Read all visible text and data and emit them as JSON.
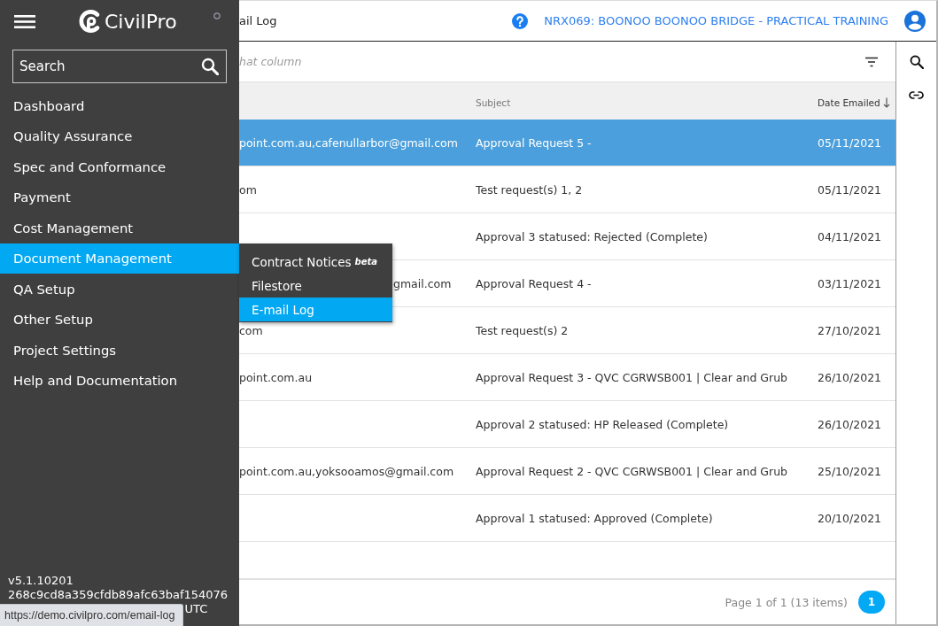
{
  "sidebar": {
    "brand": "CivilPro",
    "search": {
      "placeholder": "Search"
    },
    "items": [
      {
        "label": "Dashboard",
        "selected": false
      },
      {
        "label": "Quality Assurance",
        "selected": false
      },
      {
        "label": "Spec and Conformance",
        "selected": false
      },
      {
        "label": "Payment",
        "selected": false
      },
      {
        "label": "Cost Management",
        "selected": false
      },
      {
        "label": "Document Management",
        "selected": true,
        "expanded": true,
        "submenu": [
          {
            "label": "Contract Notices $^{beta}$",
            "selected": false
          },
          {
            "label": "Filestore",
            "selected": false
          },
          {
            "label": "E-mail Log",
            "selected": true
          }
        ]
      },
      {
        "label": "QA Setup",
        "selected": false
      },
      {
        "label": "Other Setup",
        "selected": false
      },
      {
        "label": "Project Settings",
        "selected": false
      },
      {
        "label": "Help and Documentation",
        "selected": false
      }
    ],
    "version": [
      "v5.1.10201",
      "268c9cd8a359cfdb89afc63baf154076",
      "UTC"
    ]
  },
  "header": {
    "title": "ail Log",
    "project": "NRX069: BOONOO BOONOO BRIDGE - PRACTICAL TRAINING"
  },
  "group_panel": {
    "hint": "hat column"
  },
  "table": {
    "columns": [
      {
        "label": "Subject",
        "sorted": false
      },
      {
        "label": "Date Emailed",
        "sorted": true,
        "descending": true
      }
    ],
    "rows": [
      {
        "selected": true,
        "column_1": "point.com.au,cafenullarbor@gmail.com",
        "subject": "Approval Request 5 -",
        "date": "05/11/2021"
      },
      {
        "selected": false,
        "column_1": "om",
        "subject": "Test request(s) 1, 2",
        "date": "05/11/2021"
      },
      {
        "selected": false,
        "subject": "Approval 3 statused: Rejected (Complete)",
        "date": "04/11/2021"
      },
      {
        "selected": false,
        "column_1": "gmail.com",
        "subject": "Approval Request 4 -",
        "date": "03/11/2021"
      },
      {
        "selected": false,
        "column_1": "com",
        "subject": "Test request(s) 2",
        "date": "27/10/2021"
      },
      {
        "selected": false,
        "column_1": "point.com.au",
        "subject": "Approval Request 3 - QVC CGRWSB001 | Clear and Grub",
        "date": "26/10/2021"
      },
      {
        "selected": false,
        "subject": "Approval 2 statused: HP Released (Complete)",
        "date": "26/10/2021"
      },
      {
        "selected": false,
        "column_1": "point.com.au,yoksooamos@gmail.com",
        "subject": "Approval Request 2 - QVC CGRWSB001 | Clear and Grub",
        "date": "25/10/2021"
      },
      {
        "selected": false,
        "subject": "Approval 1 statused: Approved (Complete)",
        "date": "20/10/2021"
      }
    ]
  },
  "pager": {
    "summary": "Page 1 of 1 (13 items)",
    "pages": [
      {
        "label": "1",
        "selected": true
      }
    ]
  },
  "status_url": "https://demo.civilpro.com/email-log"
}
